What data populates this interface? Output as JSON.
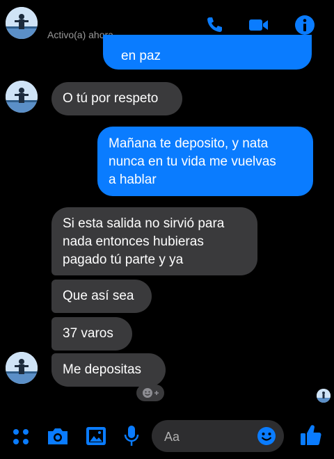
{
  "header": {
    "status": "Activo(a) ahora",
    "icons": [
      "phone-icon",
      "video-camera-icon",
      "info-icon"
    ],
    "accent": "#0a7cff"
  },
  "messages": [
    {
      "side": "out",
      "lines": [
        "en paz"
      ]
    },
    {
      "side": "in",
      "lines": [
        "O tú por respeto"
      ]
    },
    {
      "side": "out",
      "lines": [
        "Mañana te deposito, y nata",
        "nunca en tu vida me vuelvas",
        "a hablar"
      ]
    },
    {
      "side": "in",
      "lines": [
        "Si esta salida no sirvió para",
        "nada entonces hubieras",
        "pagado tú parte y ya"
      ]
    },
    {
      "side": "in",
      "lines": [
        "Que así sea"
      ]
    },
    {
      "side": "in",
      "lines": [
        "37 varos"
      ]
    },
    {
      "side": "in",
      "lines": [
        "Me depositas"
      ]
    }
  ],
  "composer": {
    "placeholder": "Aa",
    "icons": [
      "menu-dots-icon",
      "camera-icon",
      "gallery-icon",
      "microphone-icon",
      "emoji-icon",
      "thumbs-up-icon"
    ]
  },
  "colors": {
    "incoming": "#3a3a3c",
    "outgoing": "#0a7cff",
    "background": "#000000"
  }
}
